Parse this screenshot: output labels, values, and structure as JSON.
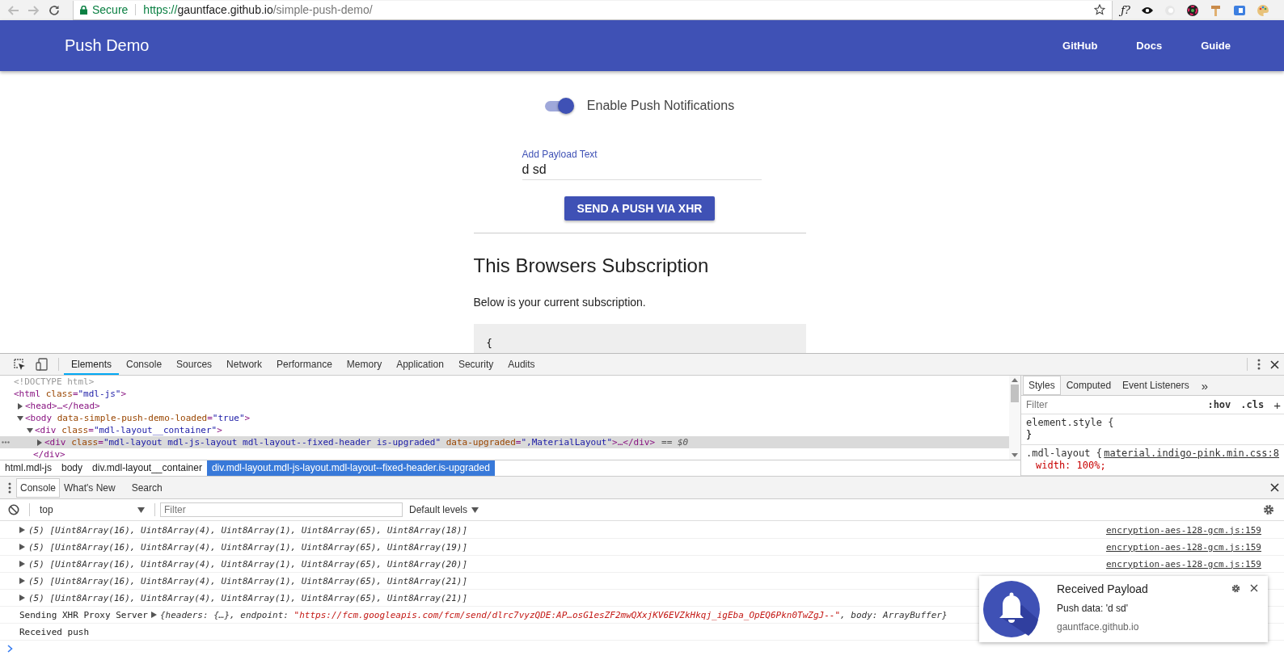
{
  "browser": {
    "secure_label": "Secure",
    "url": {
      "scheme": "https://",
      "host": "gauntface.github.io",
      "path": "/simple-push-demo/"
    },
    "extension_text": "ƒ?"
  },
  "header": {
    "title": "Push Demo",
    "nav": [
      "GitHub",
      "Docs",
      "Guide"
    ]
  },
  "page": {
    "toggle": {
      "label": "Enable Push Notifications",
      "on": true
    },
    "payload_field": {
      "label": "Add Payload Text",
      "value": "d sd"
    },
    "send_button": "SEND A PUSH VIA XHR",
    "heading": "This Browsers Subscription",
    "description": "Below is your current subscription.",
    "code_start": "{"
  },
  "devtools": {
    "tabs": [
      {
        "label": "Elements",
        "selected": true
      },
      {
        "label": "Console",
        "selected": false
      },
      {
        "label": "Sources",
        "selected": false
      },
      {
        "label": "Network",
        "selected": false
      },
      {
        "label": "Performance",
        "selected": false
      },
      {
        "label": "Memory",
        "selected": false
      },
      {
        "label": "Application",
        "selected": false
      },
      {
        "label": "Security",
        "selected": false
      },
      {
        "label": "Audits",
        "selected": false
      }
    ],
    "dom_tree": [
      {
        "kind": "doctype",
        "text": "<!DOCTYPE html>"
      },
      {
        "kind": "tag",
        "text": "<html class=\"mdl-js\">",
        "children": [
          {
            "kind": "tag",
            "text": "<head>…</head>",
            "expanded": false
          },
          {
            "kind": "tag",
            "text": "<body data-simple-push-demo-loaded=\"true\">",
            "expanded": true,
            "children": [
              {
                "kind": "tag",
                "text": "<div class=\"mdl-layout__container\">",
                "expanded": true,
                "closing": "</div>",
                "children": [
                  {
                    "kind": "tag",
                    "text": "<div class=\"mdl-layout mdl-js-layout mdl-layout--fixed-header is-upgraded\" data-upgraded=\",MaterialLayout\">…</div>",
                    "expanded": false,
                    "selected": true,
                    "suffix": "== $0"
                  }
                ]
              }
            ]
          }
        ]
      }
    ],
    "breadcrumbs": [
      {
        "label": "html.mdl-js",
        "selected": false
      },
      {
        "label": "body",
        "selected": false
      },
      {
        "label": "div.mdl-layout__container",
        "selected": false
      },
      {
        "label": "div.mdl-layout.mdl-js-layout.mdl-layout--fixed-header.is-upgraded",
        "selected": true
      }
    ],
    "styles_tabs": [
      {
        "label": "Styles",
        "selected": true
      },
      {
        "label": "Computed",
        "selected": false
      },
      {
        "label": "Event Listeners",
        "selected": false
      }
    ],
    "styles_more": "»",
    "styles_filter": {
      "placeholder": "Filter",
      "hov": ":hov",
      "cls": ".cls",
      "add": "+"
    },
    "style_rules": [
      {
        "selector": "element.style {",
        "close": "}"
      },
      {
        "selector": ".mdl-layout {",
        "source": "material.indigo-pink.min.css:8",
        "declaration": "width: 100%;"
      }
    ]
  },
  "console": {
    "tabs": [
      {
        "label": "Console",
        "selected": true
      },
      {
        "label": "What's New",
        "selected": false
      },
      {
        "label": "Search",
        "selected": false
      }
    ],
    "context": "top",
    "filter_placeholder": "Filter",
    "levels": "Default levels",
    "messages": [
      {
        "kind": "array",
        "text": "(5) [Uint8Array(16), Uint8Array(4), Uint8Array(1), Uint8Array(65), Uint8Array(18)]",
        "source": "encryption-aes-128-gcm.js:159"
      },
      {
        "kind": "array",
        "text": "(5) [Uint8Array(16), Uint8Array(4), Uint8Array(1), Uint8Array(65), Uint8Array(19)]",
        "source": "encryption-aes-128-gcm.js:159"
      },
      {
        "kind": "array",
        "text": "(5) [Uint8Array(16), Uint8Array(4), Uint8Array(1), Uint8Array(65), Uint8Array(20)]",
        "source": "encryption-aes-128-gcm.js:159"
      },
      {
        "kind": "array",
        "text": "(5) [Uint8Array(16), Uint8Array(4), Uint8Array(1), Uint8Array(65), Uint8Array(21)]"
      },
      {
        "kind": "array",
        "text": "(5) [Uint8Array(16), Uint8Array(4), Uint8Array(1), Uint8Array(65), Uint8Array(21)]"
      },
      {
        "kind": "object",
        "text": "Sending XHR Proxy Server",
        "preview": [
          {
            "kind": "plain",
            "text": "{headers: {…}, endpoint: "
          },
          {
            "kind": "string",
            "text": "\"https://fcm.googleapis.com/fcm/send/dlrc7vyzQDE:AP…osG1esZF2mwQXxjKV6EVZkHkqj_igEba_OpEQ6Pkn0TwZgJ--\""
          },
          {
            "kind": "plain",
            "text": ", body: ArrayBuffer}"
          }
        ]
      },
      {
        "kind": "log",
        "text": "Received push"
      }
    ]
  },
  "notification": {
    "title": "Received Payload",
    "body": "Push data: 'd sd'",
    "origin": "gauntface.github.io"
  }
}
